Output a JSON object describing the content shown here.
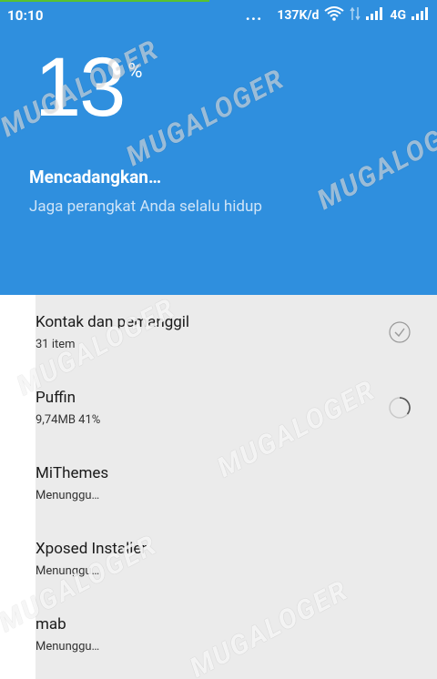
{
  "status_bar": {
    "time": "10:10",
    "more": "...",
    "speed": "137K/d",
    "network": "4G",
    "icons": [
      "wifi-icon",
      "data-arrows-icon",
      "signal-icon",
      "signal-icon"
    ]
  },
  "backup": {
    "percent": "13",
    "percent_sign": "%",
    "progress_fraction": 0.13,
    "title": "Mencadangkan…",
    "subtitle": "Jaga perangkat Anda selalu hidup"
  },
  "items": [
    {
      "name": "Kontak dan pemanggil",
      "meta": "31 item",
      "status": "done",
      "icon": "check-circle-icon"
    },
    {
      "name": "Puffin",
      "meta": "9,74MB 41%",
      "status": "in-progress",
      "icon": "progress-ring-icon"
    },
    {
      "name": "MiThemes",
      "meta": "Menunggu…",
      "status": "waiting"
    },
    {
      "name": "Xposed Installer",
      "meta": "Menunggu…",
      "status": "waiting"
    },
    {
      "name": "mab",
      "meta": "Menunggu…",
      "status": "waiting"
    }
  ],
  "watermark": "MUGALOGER",
  "colors": {
    "header": "#2f8fde",
    "list_bg": "#ebebeb",
    "progress": "#58c230"
  }
}
